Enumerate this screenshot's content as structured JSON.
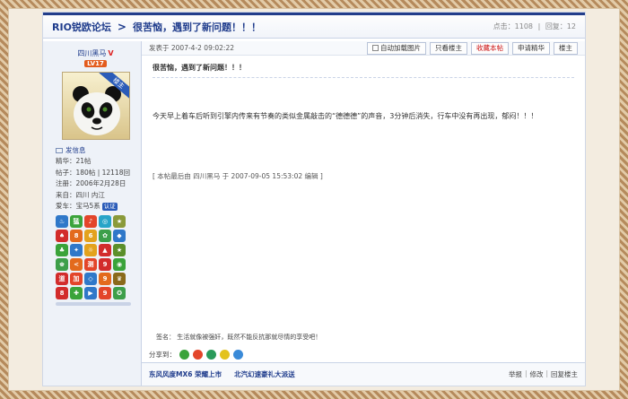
{
  "header": {
    "forum_name": "RIO锐欧论坛",
    "separator": ">",
    "thread_title": "很苦恼，遇到了新问题！！！",
    "views_label": "点击：1108",
    "replies_label": "回复：12",
    "stats_sep": "|"
  },
  "user": {
    "name": "四川黑马",
    "verified": "V",
    "level": "LV17",
    "avatar_badge": "楼主",
    "pm_label": "发信息",
    "essence": "精华：21帖",
    "posts": "帖子：180帖 | 12118回",
    "registered": "注册：2006年2月28日",
    "location": "来自：四川 内江",
    "car_label": "爱车：宝马5系",
    "car_badge": "认证"
  },
  "medals": [
    {
      "glyph": "♨",
      "color": "#2f78c9"
    },
    {
      "glyph": "猛",
      "color": "#3aa33a"
    },
    {
      "glyph": "♪",
      "color": "#e3452a"
    },
    {
      "glyph": "◎",
      "color": "#27a4c8"
    },
    {
      "glyph": "★",
      "color": "#8a9a3a"
    },
    {
      "glyph": "♠",
      "color": "#d22c2c"
    },
    {
      "glyph": "8",
      "color": "#e36a1d"
    },
    {
      "glyph": "6",
      "color": "#e3a21d"
    },
    {
      "glyph": "✿",
      "color": "#3d9f4a"
    },
    {
      "glyph": "◆",
      "color": "#2f78c9"
    },
    {
      "glyph": "♣",
      "color": "#3aa33a"
    },
    {
      "glyph": "✦",
      "color": "#2f78c9"
    },
    {
      "glyph": "☼",
      "color": "#e3a21d"
    },
    {
      "glyph": "▲",
      "color": "#d22c2c"
    },
    {
      "glyph": "★",
      "color": "#5b8f2a"
    },
    {
      "glyph": "♚",
      "color": "#3d9f4a"
    },
    {
      "glyph": "<",
      "color": "#e36a1d"
    },
    {
      "glyph": "测",
      "color": "#e3452a"
    },
    {
      "glyph": "9",
      "color": "#d22c2c"
    },
    {
      "glyph": "◉",
      "color": "#3aa33a"
    },
    {
      "glyph": "道",
      "color": "#d22c2c"
    },
    {
      "glyph": "加",
      "color": "#e3452a"
    },
    {
      "glyph": "◇",
      "color": "#2f78c9"
    },
    {
      "glyph": "9",
      "color": "#e36a1d"
    },
    {
      "glyph": "♛",
      "color": "#8a6a1a"
    },
    {
      "glyph": "8",
      "color": "#d22c2c"
    },
    {
      "glyph": "✚",
      "color": "#3aa33a"
    },
    {
      "glyph": "▶",
      "color": "#2f78c9"
    },
    {
      "glyph": "9",
      "color": "#e3452a"
    },
    {
      "glyph": "✪",
      "color": "#3d9f4a"
    }
  ],
  "post": {
    "date": "发表于 2007-4-2 09:02:22",
    "buttons": {
      "auto_load_images": "自动加载图片",
      "only_op": "只看楼主",
      "favorite": "收藏本帖",
      "apply_essence": "申请精华",
      "floor": "楼主"
    },
    "title": "很苦恼，遇到了新问题！！！",
    "body": "今天早上着车后听到引擎内传来有节奏的类似金属敲击的“德德德”的声音，3分钟后消失，行车中没有再出现，郁闷！！！",
    "edit_note": "[ 本帖最后由 四川黑马 于 2007-09-05 15:53:02 编辑 ]",
    "signature": "签名： 生活就像被强奸，既然不能反抗那就尽情的享受吧！",
    "share_label": "分享到："
  },
  "share_icons": [
    {
      "name": "wechat-icon",
      "color": "#3aa33a"
    },
    {
      "name": "weibo-icon",
      "color": "#e3452a"
    },
    {
      "name": "qzone-icon",
      "color": "#2a9a5a"
    },
    {
      "name": "star-icon",
      "color": "#e3c21d"
    },
    {
      "name": "qq-icon",
      "color": "#3a8ad8"
    }
  ],
  "footer": {
    "ad1": "东风风度MX6 荣耀上市",
    "ad2": "北汽幻速豪礼大派送",
    "report": "举报",
    "edit": "修改",
    "reply_op": "回复楼主",
    "sep": "|"
  }
}
